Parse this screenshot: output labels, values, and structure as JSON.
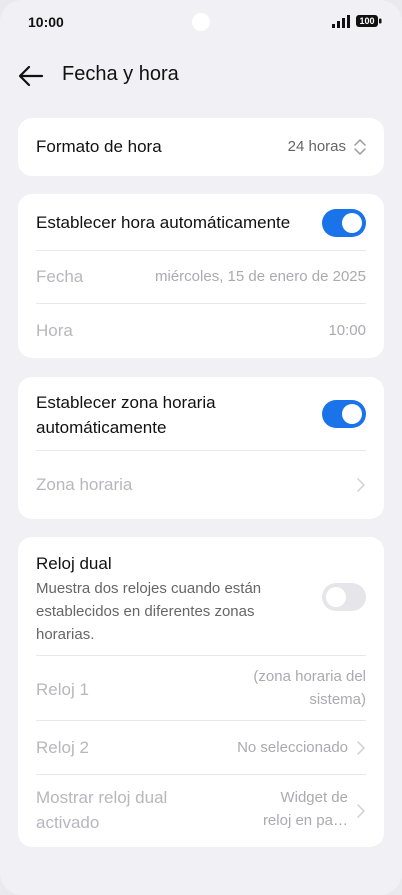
{
  "status_bar": {
    "time": "10:00",
    "battery": "100"
  },
  "header": {
    "title": "Fecha y hora"
  },
  "time_format": {
    "label": "Formato de hora",
    "value": "24 horas"
  },
  "auto_time": {
    "label": "Establecer hora automáticamente",
    "enabled": true,
    "date_label": "Fecha",
    "date_value": "miércoles, 15 de enero de 2025",
    "time_label": "Hora",
    "time_value": "10:00"
  },
  "auto_timezone": {
    "label_line1": "Establecer zona horaria",
    "label_line2": "automáticamente",
    "enabled": true,
    "timezone_label": "Zona horaria"
  },
  "dual_clock": {
    "title": "Reloj dual",
    "description_lines": [
      "Muestra dos relojes cuando están",
      "establecidos en diferentes zonas",
      "horarias."
    ],
    "enabled": false,
    "clock1_label": "Reloj 1",
    "clock1_value_lines": [
      "(zona horaria del",
      "sistema)"
    ],
    "clock2_label": "Reloj 2",
    "clock2_value": "No seleccionado",
    "show_label_lines": [
      "Mostrar reloj dual",
      "activado"
    ],
    "show_value_lines": [
      "Widget de",
      "reloj en pa…"
    ]
  },
  "colors": {
    "accent": "#1a73e8",
    "background": "#f0f0f5",
    "card": "#ffffff"
  }
}
